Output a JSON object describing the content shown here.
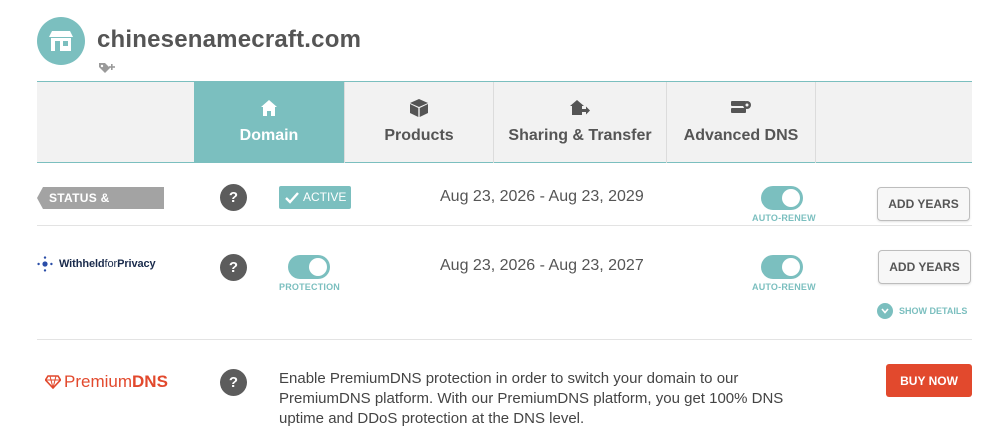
{
  "domain": {
    "name": "chinesenamecraft.com"
  },
  "tabs": [
    {
      "label": "Domain",
      "icon": "home-icon",
      "active": true
    },
    {
      "label": "Products",
      "icon": "box-icon",
      "active": false
    },
    {
      "label": "Sharing & Transfer",
      "icon": "house-arrow-icon",
      "active": false
    },
    {
      "label": "Advanced DNS",
      "icon": "server-gear-icon",
      "active": false
    }
  ],
  "status_row": {
    "label": "STATUS & VALIDITY",
    "help": "?",
    "badge": "ACTIVE",
    "dates": "Aug 23, 2026 - Aug 23, 2029",
    "autorenew_caption": "AUTO-RENEW",
    "autorenew_on": true,
    "button": "ADD YEARS"
  },
  "privacy_row": {
    "logo_bold": "Withheld",
    "logo_light": "for",
    "logo_bold2": "Privacy",
    "help": "?",
    "protection_caption": "PROTECTION",
    "protection_on": true,
    "dates": "Aug 23, 2026 - Aug 23, 2027",
    "autorenew_caption": "AUTO-RENEW",
    "autorenew_on": true,
    "button": "ADD YEARS",
    "show_details": "SHOW DETAILS"
  },
  "premiumdns_row": {
    "logo_light": "Premium",
    "logo_bold": "DNS",
    "help": "?",
    "description": "Enable PremiumDNS protection in order to switch your domain to our PremiumDNS platform. With our PremiumDNS platform, you get 100% DNS uptime and DDoS protection at the DNS level.",
    "button": "BUY NOW"
  },
  "colors": {
    "teal": "#7bbfbf",
    "orange": "#e2492d",
    "gray_label": "#a3a3a3"
  }
}
